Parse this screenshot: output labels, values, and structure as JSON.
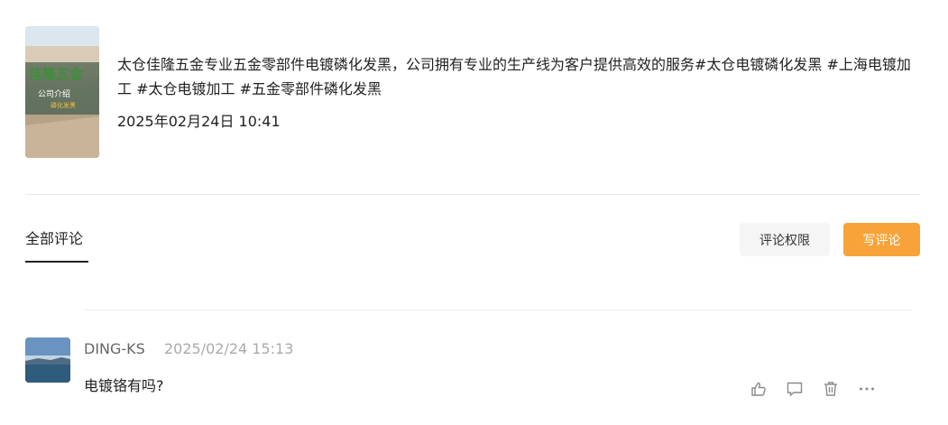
{
  "post": {
    "thumbnail": {
      "title": "佳隆五金",
      "subtitle": "公司介绍",
      "caption": "磷化发黑"
    },
    "description": "太仓佳隆五金专业五金零部件电镀磷化发黑，公司拥有专业的生产线为客户提供高效的服务#太仓电镀磷化发黑 #上海电镀加工 #太仓电镀加工 #五金零部件磷化发黑",
    "datetime": "2025年02月24日 10:41"
  },
  "comments_header": {
    "tab_all": "全部评论",
    "permission_button": "评论权限",
    "write_button": "写评论"
  },
  "comments": [
    {
      "username": "DING-KS",
      "time": "2025/02/24 15:13",
      "text": "电镀铬有吗?",
      "actions": [
        "thumb-up-icon",
        "comment-icon",
        "trash-icon",
        "more-icon"
      ]
    }
  ],
  "colors": {
    "accent": "#f8a33a",
    "muted_button": "#f5f5f5",
    "divider": "#e9e9e9"
  }
}
